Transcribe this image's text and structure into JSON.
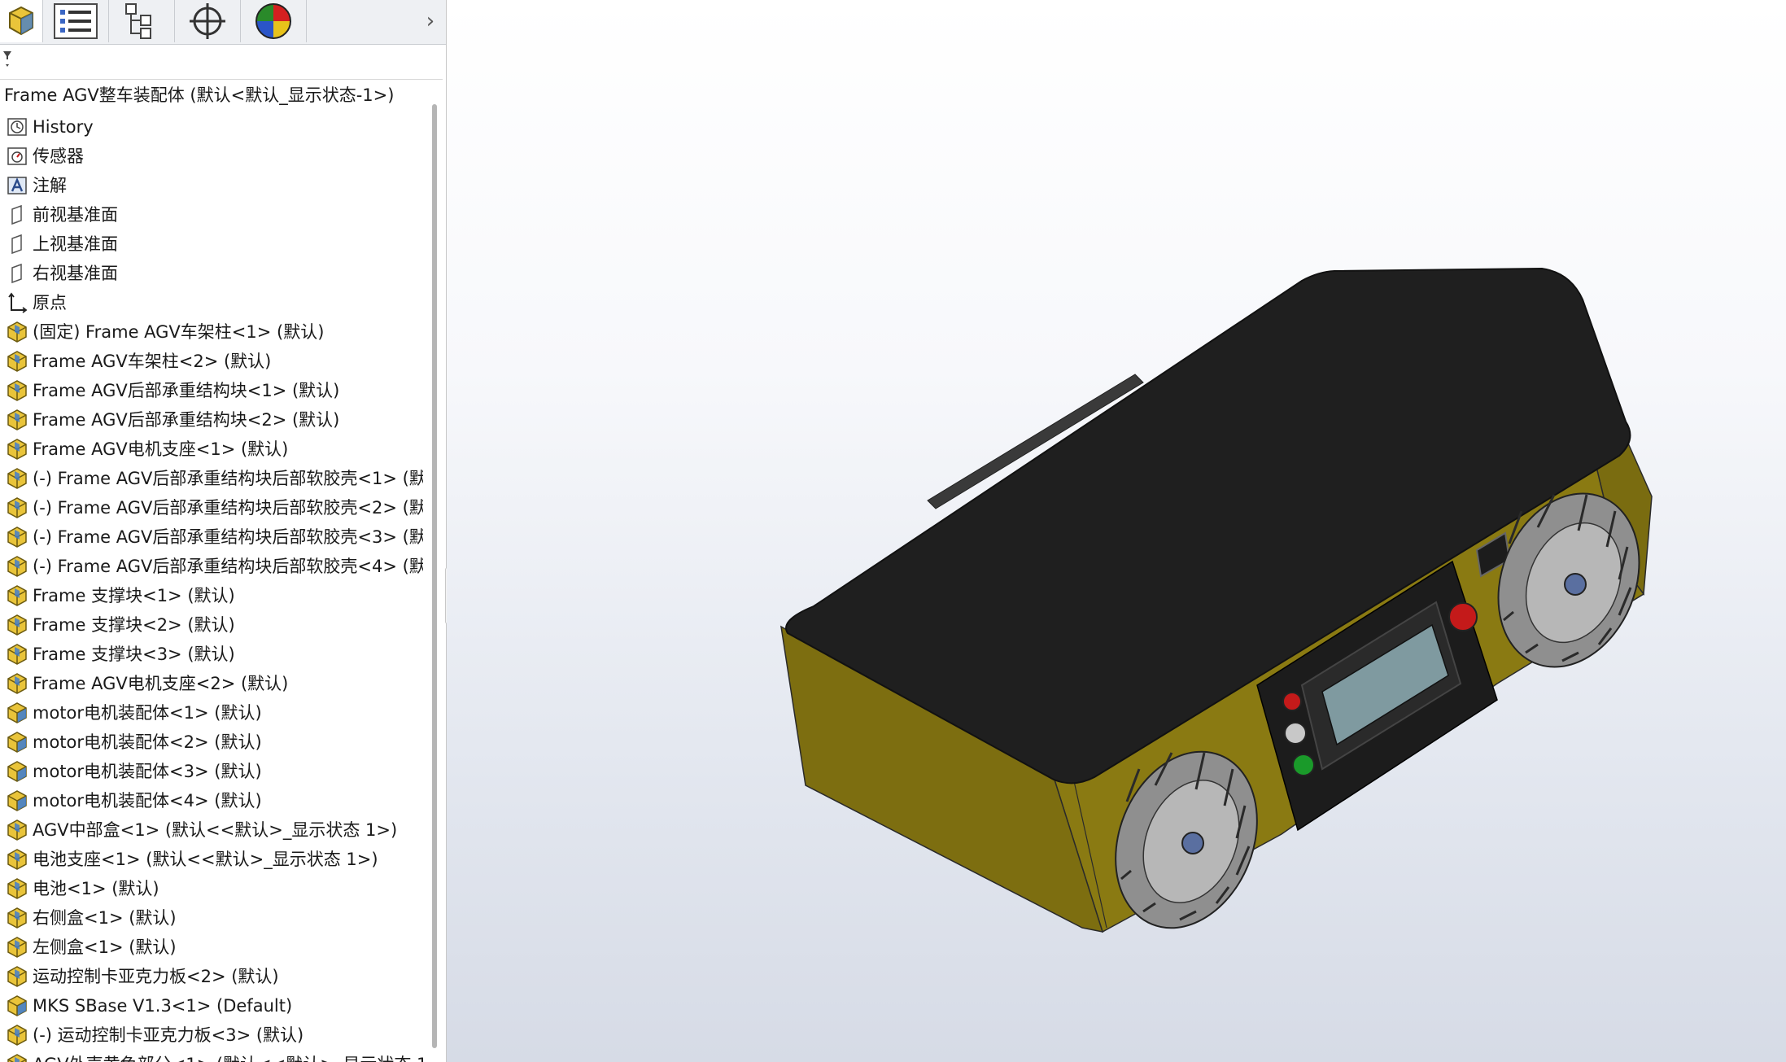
{
  "panel": {
    "tabs": [
      {
        "icon": "feature-manager-icon",
        "active": true
      },
      {
        "icon": "property-manager-icon",
        "active": false
      },
      {
        "icon": "configuration-manager-icon",
        "active": false
      },
      {
        "icon": "dimxpert-manager-icon",
        "active": false
      },
      {
        "icon": "display-manager-icon",
        "active": false
      }
    ],
    "more_tabs_arrow": "›",
    "filter_icon": "filter-icon"
  },
  "tree": {
    "root_label": "Frame AGV整车装配体  (默认<默认_显示状态-1>)",
    "items": [
      {
        "label": "History",
        "icon": "history-icon"
      },
      {
        "label": "传感器",
        "icon": "sensor-icon"
      },
      {
        "label": "注解",
        "icon": "annotation-icon"
      },
      {
        "label": "前视基准面",
        "icon": "plane-icon"
      },
      {
        "label": "上视基准面",
        "icon": "plane-icon"
      },
      {
        "label": "右视基准面",
        "icon": "plane-icon"
      },
      {
        "label": "原点",
        "icon": "origin-icon"
      },
      {
        "label": "(固定) Frame AGV车架柱<1> (默认)",
        "icon": "part-icon"
      },
      {
        "label": "Frame AGV车架柱<2> (默认)",
        "icon": "part-icon"
      },
      {
        "label": "Frame AGV后部承重结构块<1> (默认)",
        "icon": "part-icon"
      },
      {
        "label": "Frame AGV后部承重结构块<2> (默认)",
        "icon": "part-icon"
      },
      {
        "label": "Frame AGV电机支座<1> (默认)",
        "icon": "part-icon"
      },
      {
        "label": "(-) Frame AGV后部承重结构块后部软胶壳<1> (默认",
        "icon": "part-icon"
      },
      {
        "label": "(-) Frame AGV后部承重结构块后部软胶壳<2> (默认",
        "icon": "part-icon"
      },
      {
        "label": "(-) Frame AGV后部承重结构块后部软胶壳<3> (默认",
        "icon": "part-icon"
      },
      {
        "label": "(-) Frame AGV后部承重结构块后部软胶壳<4> (默认",
        "icon": "part-icon"
      },
      {
        "label": "Frame 支撑块<1> (默认)",
        "icon": "part-icon"
      },
      {
        "label": "Frame 支撑块<2> (默认)",
        "icon": "part-icon"
      },
      {
        "label": "Frame 支撑块<3> (默认)",
        "icon": "part-icon"
      },
      {
        "label": "Frame AGV电机支座<2> (默认)",
        "icon": "part-icon"
      },
      {
        "label": "motor电机装配体<1> (默认)",
        "icon": "assembly-icon"
      },
      {
        "label": "motor电机装配体<2> (默认)",
        "icon": "assembly-icon"
      },
      {
        "label": "motor电机装配体<3> (默认)",
        "icon": "assembly-icon"
      },
      {
        "label": "motor电机装配体<4> (默认)",
        "icon": "assembly-icon"
      },
      {
        "label": "AGV中部盒<1> (默认<<默认>_显示状态 1>)",
        "icon": "part-icon"
      },
      {
        "label": "电池支座<1> (默认<<默认>_显示状态 1>)",
        "icon": "part-icon"
      },
      {
        "label": "电池<1> (默认)",
        "icon": "part-icon"
      },
      {
        "label": "右侧盒<1> (默认)",
        "icon": "part-icon"
      },
      {
        "label": "左侧盒<1> (默认)",
        "icon": "part-icon"
      },
      {
        "label": "运动控制卡亚克力板<2> (默认)",
        "icon": "part-icon"
      },
      {
        "label": "MKS SBase V1.3<1> (Default)",
        "icon": "assembly-icon"
      },
      {
        "label": "(-) 运动控制卡亚克力板<3> (默认)",
        "icon": "part-icon"
      },
      {
        "label": "AGV外壳黄色部分<1> (默认<<默认>_显示状态 1>",
        "icon": "part-icon"
      }
    ]
  },
  "viewport": {
    "model": "agv-assembly-model",
    "colors": {
      "shell_yellow": "#8a7a12",
      "shell_yellow_dark": "#5c520c",
      "top_black": "#1f1f1f",
      "screen": "#7f9aa0",
      "wheel": "#9c9c9c",
      "button_red": "#c41a1a",
      "button_green": "#1a9a2a"
    }
  }
}
